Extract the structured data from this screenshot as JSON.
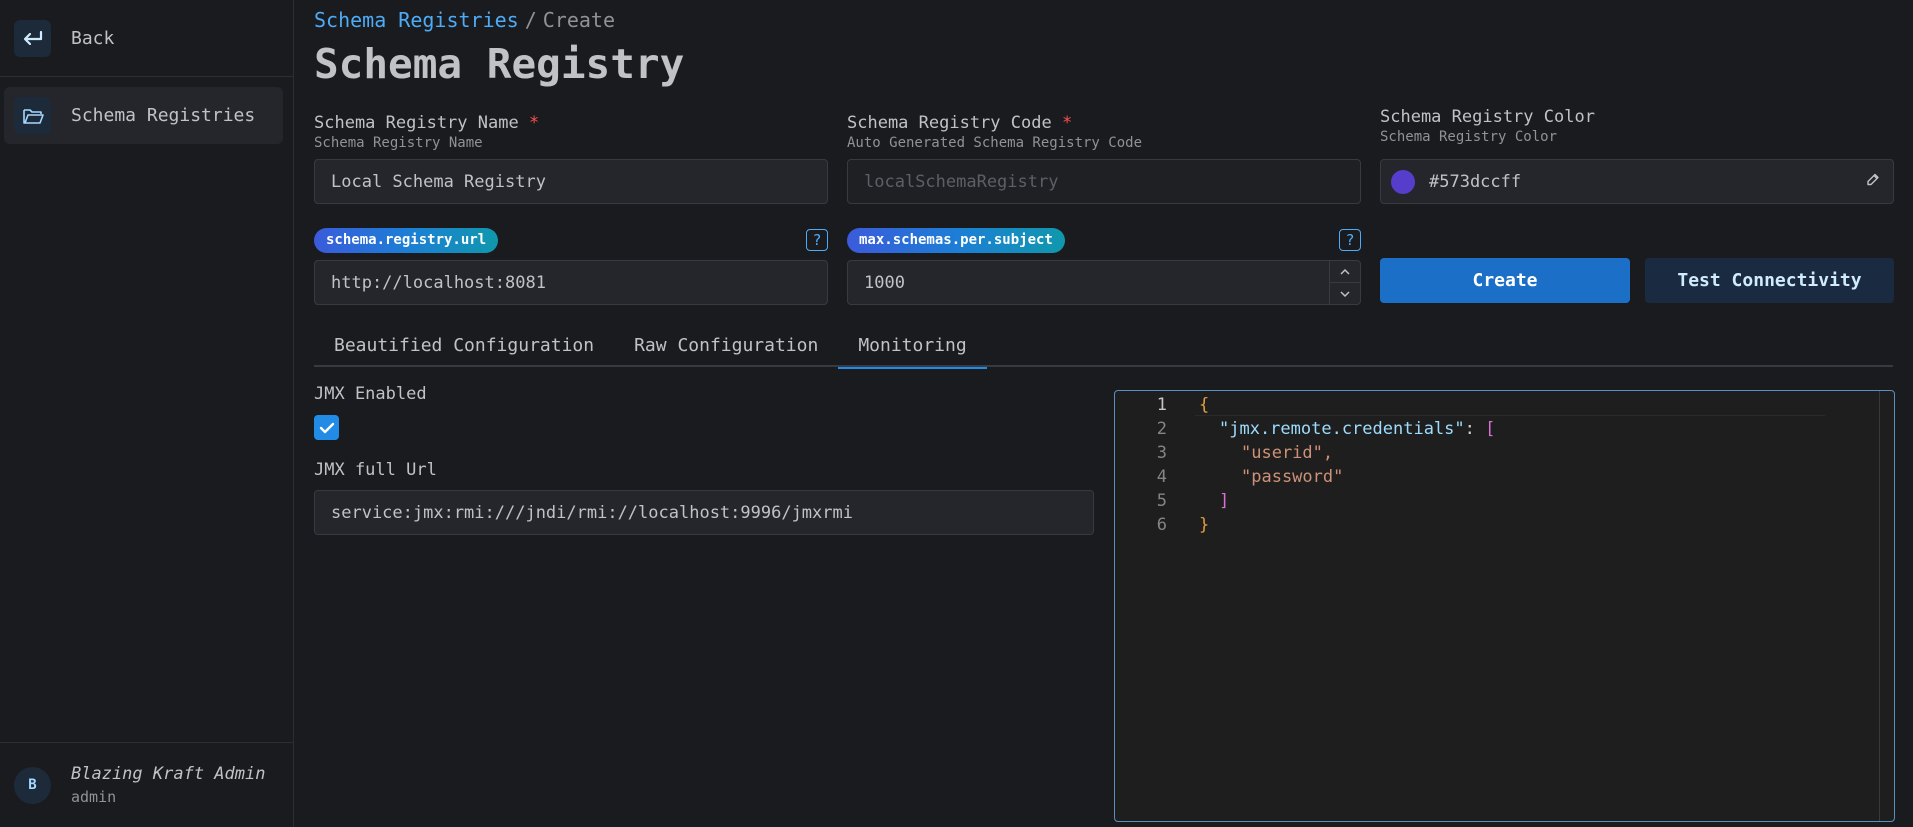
{
  "sidebar": {
    "back_label": "Back",
    "items": [
      {
        "label": "Schema Registries",
        "icon": "folder-icon"
      }
    ],
    "user": {
      "initial": "B",
      "name": "Blazing Kraft Admin",
      "role": "admin"
    }
  },
  "breadcrumb": {
    "link": "Schema Registries",
    "separator": "/",
    "current": "Create"
  },
  "page_title": "Schema Registry",
  "form": {
    "name": {
      "label": "Schema Registry Name",
      "required": "*",
      "description": "Schema Registry Name",
      "value": "Local Schema Registry"
    },
    "code": {
      "label": "Schema Registry Code",
      "required": "*",
      "description": "Auto Generated Schema Registry Code",
      "value": "localSchemaRegistry"
    },
    "color": {
      "label": "Schema Registry Color",
      "description": "Schema Registry Color",
      "value": "#573dccff",
      "swatch": "#573dcc"
    },
    "url": {
      "tag": "schema.registry.url",
      "help": "?",
      "value": "http://localhost:8081"
    },
    "max_schemas": {
      "tag": "max.schemas.per.subject",
      "help": "?",
      "value": "1000"
    }
  },
  "buttons": {
    "create": "Create",
    "test": "Test Connectivity"
  },
  "tabs": [
    {
      "label": "Beautified Configuration",
      "active": false
    },
    {
      "label": "Raw Configuration",
      "active": false
    },
    {
      "label": "Monitoring",
      "active": true
    }
  ],
  "monitoring": {
    "jmx_enabled_label": "JMX Enabled",
    "jmx_enabled": true,
    "jmx_url_label": "JMX full Url",
    "jmx_url_value": "service:jmx:rmi:///jndi/rmi://localhost:9996/jmxrmi"
  },
  "editor": {
    "lines": [
      {
        "n": "1",
        "text": "{"
      },
      {
        "n": "2",
        "text": "\"jmx.remote.credentials\": ["
      },
      {
        "n": "3",
        "text": "\"userid\","
      },
      {
        "n": "4",
        "text": "\"password\""
      },
      {
        "n": "5",
        "text": "]"
      },
      {
        "n": "6",
        "text": "}"
      }
    ]
  },
  "colors": {
    "accent": "#228be6",
    "link": "#4dabf7",
    "background": "#1a1b1e",
    "required": "#fa5252"
  }
}
